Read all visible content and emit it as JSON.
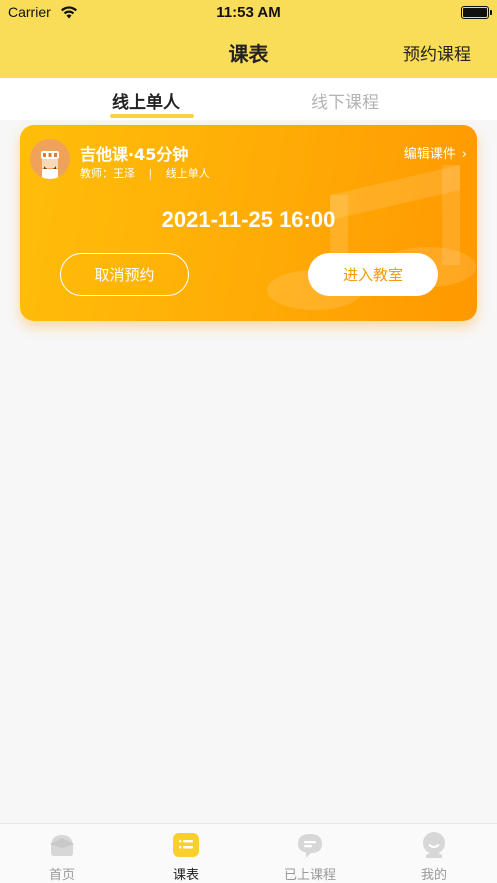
{
  "status_bar": {
    "carrier": "Carrier",
    "time": "11:53 AM"
  },
  "nav": {
    "title": "课表",
    "action": "预约课程"
  },
  "tabs": [
    {
      "label": "线上单人",
      "active": true
    },
    {
      "label": "线下课程",
      "active": false
    }
  ],
  "card": {
    "avatar": "teacher-avatar",
    "title": "吉他课·45分钟",
    "teacher_label": "教师：王泽",
    "separator": "|",
    "mode": "线上单人",
    "edit_label": "编辑课件",
    "datetime": "2021-11-25 16:00",
    "cancel_label": "取消预约",
    "enter_label": "进入教室"
  },
  "tabbar": [
    {
      "label": "首页",
      "icon": "home-icon",
      "active": false
    },
    {
      "label": "课表",
      "icon": "schedule-icon",
      "active": true
    },
    {
      "label": "已上课程",
      "icon": "chat-bubble-icon",
      "active": false
    },
    {
      "label": "我的",
      "icon": "profile-icon",
      "active": false
    }
  ],
  "colors": {
    "header": "#f9dc58",
    "accent": "#f9d442",
    "card_start": "#ffbe0a",
    "card_end": "#ff9800",
    "enter_text": "#f39a0f"
  }
}
